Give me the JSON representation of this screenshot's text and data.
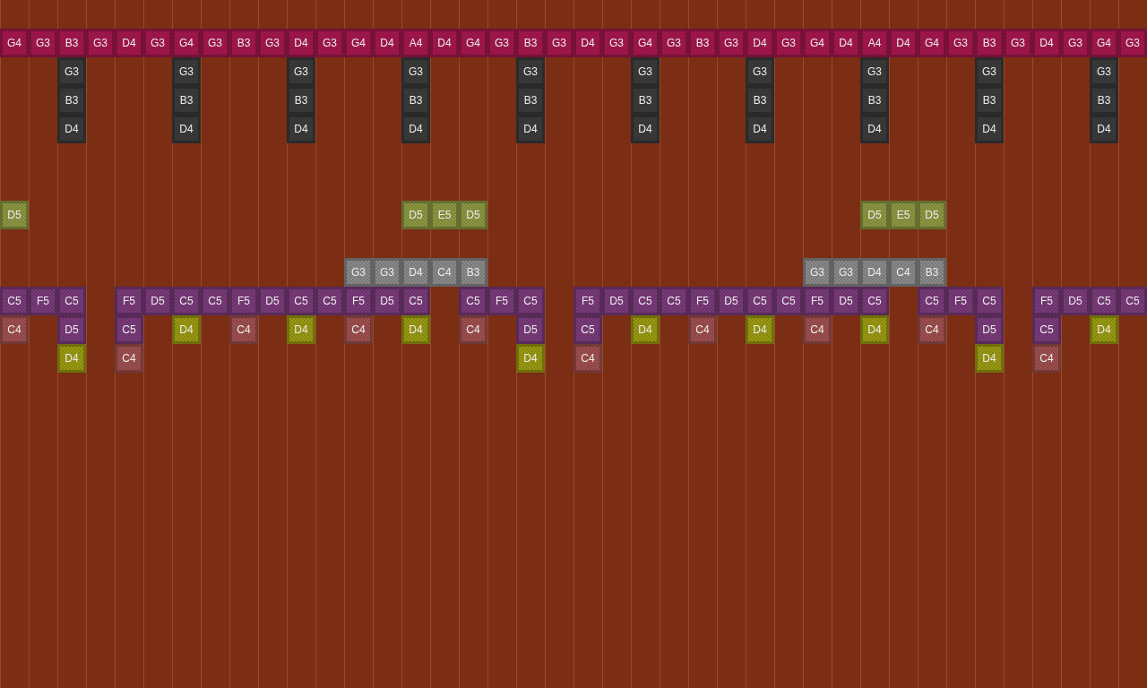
{
  "piano_roll": {
    "rows": [
      {
        "kind": "empty"
      },
      {
        "kind": "notes",
        "cells": [
          {
            "kind": "note",
            "label": "G4",
            "color": "#a5174e"
          },
          {
            "kind": "note",
            "label": "G3",
            "color": "#a5174e"
          },
          {
            "kind": "note",
            "label": "B3",
            "color": "#a5174e"
          },
          {
            "kind": "note",
            "label": "G3",
            "color": "#a5174e"
          },
          {
            "kind": "note",
            "label": "D4",
            "color": "#a5174e"
          },
          {
            "kind": "note",
            "label": "G3",
            "color": "#a5174e"
          },
          {
            "kind": "note",
            "label": "G4",
            "color": "#a5174e"
          },
          {
            "kind": "note",
            "label": "G3",
            "color": "#a5174e"
          },
          {
            "kind": "note",
            "label": "B3",
            "color": "#a5174e"
          },
          {
            "kind": "note",
            "label": "G3",
            "color": "#a5174e"
          },
          {
            "kind": "note",
            "label": "D4",
            "color": "#a5174e"
          },
          {
            "kind": "note",
            "label": "G3",
            "color": "#a5174e"
          },
          {
            "kind": "note",
            "label": "G4",
            "color": "#a5174e"
          },
          {
            "kind": "note",
            "label": "D4",
            "color": "#a5174e"
          },
          {
            "kind": "note",
            "label": "A4",
            "color": "#a5174e"
          },
          {
            "kind": "note",
            "label": "D4",
            "color": "#a5174e"
          },
          {
            "kind": "note",
            "label": "G4",
            "color": "#a5174e"
          },
          {
            "kind": "note",
            "label": "G3",
            "color": "#a5174e"
          },
          {
            "kind": "note",
            "label": "B3",
            "color": "#a5174e"
          },
          {
            "kind": "note",
            "label": "G3",
            "color": "#a5174e"
          },
          {
            "kind": "note",
            "label": "D4",
            "color": "#a5174e"
          },
          {
            "kind": "note",
            "label": "G3",
            "color": "#a5174e"
          },
          {
            "kind": "note",
            "label": "G4",
            "color": "#a5174e"
          },
          {
            "kind": "note",
            "label": "G3",
            "color": "#a5174e"
          },
          {
            "kind": "note",
            "label": "B3",
            "color": "#a5174e"
          },
          {
            "kind": "note",
            "label": "G3",
            "color": "#a5174e"
          },
          {
            "kind": "note",
            "label": "D4",
            "color": "#a5174e"
          },
          {
            "kind": "note",
            "label": "G3",
            "color": "#a5174e"
          },
          {
            "kind": "note",
            "label": "G4",
            "color": "#a5174e"
          },
          {
            "kind": "note",
            "label": "D4",
            "color": "#a5174e"
          },
          {
            "kind": "note",
            "label": "A4",
            "color": "#a5174e"
          },
          {
            "kind": "note",
            "label": "D4",
            "color": "#a5174e"
          },
          {
            "kind": "note",
            "label": "G4",
            "color": "#a5174e"
          },
          {
            "kind": "note",
            "label": "G3",
            "color": "#a5174e"
          },
          {
            "kind": "note",
            "label": "B3",
            "color": "#a5174e"
          },
          {
            "kind": "note",
            "label": "G3",
            "color": "#a5174e"
          },
          {
            "kind": "note",
            "label": "D4",
            "color": "#a5174e"
          },
          {
            "kind": "note",
            "label": "G3",
            "color": "#a5174e"
          },
          {
            "kind": "note",
            "label": "G4",
            "color": "#a5174e"
          },
          {
            "kind": "note",
            "label": "G3",
            "color": "#a5174e"
          }
        ]
      },
      {
        "kind": "notes",
        "cells": [
          {
            "kind": "rest"
          },
          {
            "kind": "rest"
          },
          {
            "kind": "note",
            "label": "G3",
            "color": "#3b3b3b"
          },
          {
            "kind": "rest"
          },
          {
            "kind": "rest"
          },
          {
            "kind": "rest"
          },
          {
            "kind": "note",
            "label": "G3",
            "color": "#3b3b3b"
          },
          {
            "kind": "rest"
          },
          {
            "kind": "rest"
          },
          {
            "kind": "rest"
          },
          {
            "kind": "note",
            "label": "G3",
            "color": "#3b3b3b"
          },
          {
            "kind": "rest"
          },
          {
            "kind": "rest"
          },
          {
            "kind": "rest"
          },
          {
            "kind": "note",
            "label": "G3",
            "color": "#3b3b3b"
          },
          {
            "kind": "rest"
          },
          {
            "kind": "rest"
          },
          {
            "kind": "rest"
          },
          {
            "kind": "note",
            "label": "G3",
            "color": "#3b3b3b"
          },
          {
            "kind": "rest"
          },
          {
            "kind": "rest"
          },
          {
            "kind": "rest"
          },
          {
            "kind": "note",
            "label": "G3",
            "color": "#3b3b3b"
          },
          {
            "kind": "rest"
          },
          {
            "kind": "rest"
          },
          {
            "kind": "rest"
          },
          {
            "kind": "note",
            "label": "G3",
            "color": "#3b3b3b"
          },
          {
            "kind": "rest"
          },
          {
            "kind": "rest"
          },
          {
            "kind": "rest"
          },
          {
            "kind": "note",
            "label": "G3",
            "color": "#3b3b3b"
          },
          {
            "kind": "rest"
          },
          {
            "kind": "rest"
          },
          {
            "kind": "rest"
          },
          {
            "kind": "note",
            "label": "G3",
            "color": "#3b3b3b"
          },
          {
            "kind": "rest"
          },
          {
            "kind": "rest"
          },
          {
            "kind": "rest"
          },
          {
            "kind": "note",
            "label": "G3",
            "color": "#3b3b3b"
          }
        ]
      },
      {
        "kind": "notes",
        "cells": [
          {
            "kind": "rest"
          },
          {
            "kind": "rest"
          },
          {
            "kind": "note",
            "label": "B3",
            "color": "#3b3b3b"
          },
          {
            "kind": "rest"
          },
          {
            "kind": "rest"
          },
          {
            "kind": "rest"
          },
          {
            "kind": "note",
            "label": "B3",
            "color": "#3b3b3b"
          },
          {
            "kind": "rest"
          },
          {
            "kind": "rest"
          },
          {
            "kind": "rest"
          },
          {
            "kind": "note",
            "label": "B3",
            "color": "#3b3b3b"
          },
          {
            "kind": "rest"
          },
          {
            "kind": "rest"
          },
          {
            "kind": "rest"
          },
          {
            "kind": "note",
            "label": "B3",
            "color": "#3b3b3b"
          },
          {
            "kind": "rest"
          },
          {
            "kind": "rest"
          },
          {
            "kind": "rest"
          },
          {
            "kind": "note",
            "label": "B3",
            "color": "#3b3b3b"
          },
          {
            "kind": "rest"
          },
          {
            "kind": "rest"
          },
          {
            "kind": "rest"
          },
          {
            "kind": "note",
            "label": "B3",
            "color": "#3b3b3b"
          },
          {
            "kind": "rest"
          },
          {
            "kind": "rest"
          },
          {
            "kind": "rest"
          },
          {
            "kind": "note",
            "label": "B3",
            "color": "#3b3b3b"
          },
          {
            "kind": "rest"
          },
          {
            "kind": "rest"
          },
          {
            "kind": "rest"
          },
          {
            "kind": "note",
            "label": "B3",
            "color": "#3b3b3b"
          },
          {
            "kind": "rest"
          },
          {
            "kind": "rest"
          },
          {
            "kind": "rest"
          },
          {
            "kind": "note",
            "label": "B3",
            "color": "#3b3b3b"
          },
          {
            "kind": "rest"
          },
          {
            "kind": "rest"
          },
          {
            "kind": "rest"
          },
          {
            "kind": "note",
            "label": "B3",
            "color": "#3b3b3b"
          }
        ]
      },
      {
        "kind": "notes",
        "cells": [
          {
            "kind": "rest"
          },
          {
            "kind": "rest"
          },
          {
            "kind": "note",
            "label": "D4",
            "color": "#3b3b3b"
          },
          {
            "kind": "rest"
          },
          {
            "kind": "rest"
          },
          {
            "kind": "rest"
          },
          {
            "kind": "note",
            "label": "D4",
            "color": "#3b3b3b"
          },
          {
            "kind": "rest"
          },
          {
            "kind": "rest"
          },
          {
            "kind": "rest"
          },
          {
            "kind": "note",
            "label": "D4",
            "color": "#3b3b3b"
          },
          {
            "kind": "rest"
          },
          {
            "kind": "rest"
          },
          {
            "kind": "rest"
          },
          {
            "kind": "note",
            "label": "D4",
            "color": "#3b3b3b"
          },
          {
            "kind": "rest"
          },
          {
            "kind": "rest"
          },
          {
            "kind": "rest"
          },
          {
            "kind": "note",
            "label": "D4",
            "color": "#3b3b3b"
          },
          {
            "kind": "rest"
          },
          {
            "kind": "rest"
          },
          {
            "kind": "rest"
          },
          {
            "kind": "note",
            "label": "D4",
            "color": "#3b3b3b"
          },
          {
            "kind": "rest"
          },
          {
            "kind": "rest"
          },
          {
            "kind": "rest"
          },
          {
            "kind": "note",
            "label": "D4",
            "color": "#3b3b3b"
          },
          {
            "kind": "rest"
          },
          {
            "kind": "rest"
          },
          {
            "kind": "rest"
          },
          {
            "kind": "note",
            "label": "D4",
            "color": "#3b3b3b"
          },
          {
            "kind": "rest"
          },
          {
            "kind": "rest"
          },
          {
            "kind": "rest"
          },
          {
            "kind": "note",
            "label": "D4",
            "color": "#3b3b3b"
          },
          {
            "kind": "rest"
          },
          {
            "kind": "rest"
          },
          {
            "kind": "rest"
          },
          {
            "kind": "note",
            "label": "D4",
            "color": "#3b3b3b"
          }
        ]
      },
      {
        "kind": "empty"
      },
      {
        "kind": "empty"
      },
      {
        "kind": "notes",
        "cells": [
          {
            "kind": "note",
            "label": "D5",
            "color": "#8d9841"
          },
          {
            "kind": "rest"
          },
          {
            "kind": "rest"
          },
          {
            "kind": "rest"
          },
          {
            "kind": "rest"
          },
          {
            "kind": "rest"
          },
          {
            "kind": "rest"
          },
          {
            "kind": "rest"
          },
          {
            "kind": "rest"
          },
          {
            "kind": "rest"
          },
          {
            "kind": "rest"
          },
          {
            "kind": "rest"
          },
          {
            "kind": "rest"
          },
          {
            "kind": "rest"
          },
          {
            "kind": "note",
            "label": "D5",
            "color": "#8d9841"
          },
          {
            "kind": "note",
            "label": "E5",
            "color": "#8d9841"
          },
          {
            "kind": "note",
            "label": "D5",
            "color": "#8d9841"
          },
          {
            "kind": "rest"
          },
          {
            "kind": "rest"
          },
          {
            "kind": "rest"
          },
          {
            "kind": "rest"
          },
          {
            "kind": "rest"
          },
          {
            "kind": "rest"
          },
          {
            "kind": "rest"
          },
          {
            "kind": "rest"
          },
          {
            "kind": "rest"
          },
          {
            "kind": "rest"
          },
          {
            "kind": "rest"
          },
          {
            "kind": "rest"
          },
          {
            "kind": "rest"
          },
          {
            "kind": "note",
            "label": "D5",
            "color": "#8d9841"
          },
          {
            "kind": "note",
            "label": "E5",
            "color": "#8d9841"
          },
          {
            "kind": "note",
            "label": "D5",
            "color": "#8d9841"
          }
        ]
      },
      {
        "kind": "empty"
      },
      {
        "kind": "notes",
        "cells": [
          {
            "kind": "rest"
          },
          {
            "kind": "rest"
          },
          {
            "kind": "rest"
          },
          {
            "kind": "rest"
          },
          {
            "kind": "rest"
          },
          {
            "kind": "rest"
          },
          {
            "kind": "rest"
          },
          {
            "kind": "rest"
          },
          {
            "kind": "rest"
          },
          {
            "kind": "rest"
          },
          {
            "kind": "rest"
          },
          {
            "kind": "rest"
          },
          {
            "kind": "note",
            "label": "G3",
            "color": "#8a8a8a"
          },
          {
            "kind": "note",
            "label": "G3",
            "color": "#8a8a8a"
          },
          {
            "kind": "note",
            "label": "D4",
            "color": "#8a8a8a"
          },
          {
            "kind": "note",
            "label": "C4",
            "color": "#8a8a8a"
          },
          {
            "kind": "note",
            "label": "B3",
            "color": "#8a8a8a"
          },
          {
            "kind": "rest"
          },
          {
            "kind": "rest"
          },
          {
            "kind": "rest"
          },
          {
            "kind": "rest"
          },
          {
            "kind": "rest"
          },
          {
            "kind": "rest"
          },
          {
            "kind": "rest"
          },
          {
            "kind": "rest"
          },
          {
            "kind": "rest"
          },
          {
            "kind": "rest"
          },
          {
            "kind": "rest"
          },
          {
            "kind": "note",
            "label": "G3",
            "color": "#8a8a8a"
          },
          {
            "kind": "note",
            "label": "G3",
            "color": "#8a8a8a"
          },
          {
            "kind": "note",
            "label": "D4",
            "color": "#8a8a8a"
          },
          {
            "kind": "note",
            "label": "C4",
            "color": "#8a8a8a"
          },
          {
            "kind": "note",
            "label": "B3",
            "color": "#8a8a8a"
          }
        ]
      },
      {
        "kind": "notes",
        "cells": [
          {
            "kind": "note",
            "label": "C5",
            "color": "#7a3b7a"
          },
          {
            "kind": "note",
            "label": "F5",
            "color": "#7a3b7a"
          },
          {
            "kind": "note",
            "label": "C5",
            "color": "#7a3b7a"
          },
          {
            "kind": "rest"
          },
          {
            "kind": "note",
            "label": "F5",
            "color": "#7a3b7a"
          },
          {
            "kind": "note",
            "label": "D5",
            "color": "#7a3b7a"
          },
          {
            "kind": "note",
            "label": "C5",
            "color": "#7a3b7a"
          },
          {
            "kind": "note",
            "label": "C5",
            "color": "#7a3b7a"
          },
          {
            "kind": "note",
            "label": "F5",
            "color": "#7a3b7a"
          },
          {
            "kind": "note",
            "label": "D5",
            "color": "#7a3b7a"
          },
          {
            "kind": "note",
            "label": "C5",
            "color": "#7a3b7a"
          },
          {
            "kind": "note",
            "label": "C5",
            "color": "#7a3b7a"
          },
          {
            "kind": "note",
            "label": "F5",
            "color": "#7a3b7a"
          },
          {
            "kind": "note",
            "label": "D5",
            "color": "#7a3b7a"
          },
          {
            "kind": "note",
            "label": "C5",
            "color": "#7a3b7a"
          },
          {
            "kind": "rest"
          },
          {
            "kind": "note",
            "label": "C5",
            "color": "#7a3b7a"
          },
          {
            "kind": "note",
            "label": "F5",
            "color": "#7a3b7a"
          },
          {
            "kind": "note",
            "label": "C5",
            "color": "#7a3b7a"
          },
          {
            "kind": "rest"
          },
          {
            "kind": "note",
            "label": "F5",
            "color": "#7a3b7a"
          },
          {
            "kind": "note",
            "label": "D5",
            "color": "#7a3b7a"
          },
          {
            "kind": "note",
            "label": "C5",
            "color": "#7a3b7a"
          },
          {
            "kind": "note",
            "label": "C5",
            "color": "#7a3b7a"
          },
          {
            "kind": "note",
            "label": "F5",
            "color": "#7a3b7a"
          },
          {
            "kind": "note",
            "label": "D5",
            "color": "#7a3b7a"
          },
          {
            "kind": "note",
            "label": "C5",
            "color": "#7a3b7a"
          },
          {
            "kind": "note",
            "label": "C5",
            "color": "#7a3b7a"
          },
          {
            "kind": "note",
            "label": "F5",
            "color": "#7a3b7a"
          },
          {
            "kind": "note",
            "label": "D5",
            "color": "#7a3b7a"
          },
          {
            "kind": "note",
            "label": "C5",
            "color": "#7a3b7a"
          },
          {
            "kind": "rest"
          },
          {
            "kind": "note",
            "label": "C5",
            "color": "#7a3b7a"
          },
          {
            "kind": "note",
            "label": "F5",
            "color": "#7a3b7a"
          },
          {
            "kind": "note",
            "label": "C5",
            "color": "#7a3b7a"
          },
          {
            "kind": "rest"
          },
          {
            "kind": "note",
            "label": "F5",
            "color": "#7a3b7a"
          },
          {
            "kind": "note",
            "label": "D5",
            "color": "#7a3b7a"
          },
          {
            "kind": "note",
            "label": "C5",
            "color": "#7a3b7a"
          },
          {
            "kind": "note",
            "label": "C5",
            "color": "#7a3b7a"
          }
        ]
      },
      {
        "kind": "notes",
        "cells": [
          {
            "kind": "note",
            "label": "C4",
            "color": "#9e4f4e"
          },
          {
            "kind": "rest"
          },
          {
            "kind": "note",
            "label": "D5",
            "color": "#7a3b7a"
          },
          {
            "kind": "rest"
          },
          {
            "kind": "note",
            "label": "C5",
            "color": "#7a3b7a"
          },
          {
            "kind": "rest"
          },
          {
            "kind": "note",
            "label": "D4",
            "color": "#9a9a12"
          },
          {
            "kind": "rest"
          },
          {
            "kind": "note",
            "label": "C4",
            "color": "#9e4f4e"
          },
          {
            "kind": "rest"
          },
          {
            "kind": "note",
            "label": "D4",
            "color": "#9a9a12"
          },
          {
            "kind": "rest"
          },
          {
            "kind": "note",
            "label": "C4",
            "color": "#9e4f4e"
          },
          {
            "kind": "rest"
          },
          {
            "kind": "note",
            "label": "D4",
            "color": "#9a9a12"
          },
          {
            "kind": "rest"
          },
          {
            "kind": "note",
            "label": "C4",
            "color": "#9e4f4e"
          },
          {
            "kind": "rest"
          },
          {
            "kind": "note",
            "label": "D5",
            "color": "#7a3b7a"
          },
          {
            "kind": "rest"
          },
          {
            "kind": "note",
            "label": "C5",
            "color": "#7a3b7a"
          },
          {
            "kind": "rest"
          },
          {
            "kind": "note",
            "label": "D4",
            "color": "#9a9a12"
          },
          {
            "kind": "rest"
          },
          {
            "kind": "note",
            "label": "C4",
            "color": "#9e4f4e"
          },
          {
            "kind": "rest"
          },
          {
            "kind": "note",
            "label": "D4",
            "color": "#9a9a12"
          },
          {
            "kind": "rest"
          },
          {
            "kind": "note",
            "label": "C4",
            "color": "#9e4f4e"
          },
          {
            "kind": "rest"
          },
          {
            "kind": "note",
            "label": "D4",
            "color": "#9a9a12"
          },
          {
            "kind": "rest"
          },
          {
            "kind": "note",
            "label": "C4",
            "color": "#9e4f4e"
          },
          {
            "kind": "rest"
          },
          {
            "kind": "note",
            "label": "D5",
            "color": "#7a3b7a"
          },
          {
            "kind": "rest"
          },
          {
            "kind": "note",
            "label": "C5",
            "color": "#7a3b7a"
          },
          {
            "kind": "rest"
          },
          {
            "kind": "note",
            "label": "D4",
            "color": "#9a9a12"
          }
        ]
      },
      {
        "kind": "notes",
        "cells": [
          {
            "kind": "rest"
          },
          {
            "kind": "rest"
          },
          {
            "kind": "note",
            "label": "D4",
            "color": "#9a9a12"
          },
          {
            "kind": "rest"
          },
          {
            "kind": "note",
            "label": "C4",
            "color": "#9e4f4e"
          },
          {
            "kind": "rest"
          },
          {
            "kind": "rest"
          },
          {
            "kind": "rest"
          },
          {
            "kind": "rest"
          },
          {
            "kind": "rest"
          },
          {
            "kind": "rest"
          },
          {
            "kind": "rest"
          },
          {
            "kind": "rest"
          },
          {
            "kind": "rest"
          },
          {
            "kind": "rest"
          },
          {
            "kind": "rest"
          },
          {
            "kind": "rest"
          },
          {
            "kind": "rest"
          },
          {
            "kind": "note",
            "label": "D4",
            "color": "#9a9a12"
          },
          {
            "kind": "rest"
          },
          {
            "kind": "note",
            "label": "C4",
            "color": "#9e4f4e"
          },
          {
            "kind": "rest"
          },
          {
            "kind": "rest"
          },
          {
            "kind": "rest"
          },
          {
            "kind": "rest"
          },
          {
            "kind": "rest"
          },
          {
            "kind": "rest"
          },
          {
            "kind": "rest"
          },
          {
            "kind": "rest"
          },
          {
            "kind": "rest"
          },
          {
            "kind": "rest"
          },
          {
            "kind": "rest"
          },
          {
            "kind": "rest"
          },
          {
            "kind": "rest"
          },
          {
            "kind": "note",
            "label": "D4",
            "color": "#9a9a12"
          },
          {
            "kind": "rest"
          },
          {
            "kind": "note",
            "label": "C4",
            "color": "#9e4f4e"
          }
        ]
      }
    ]
  }
}
